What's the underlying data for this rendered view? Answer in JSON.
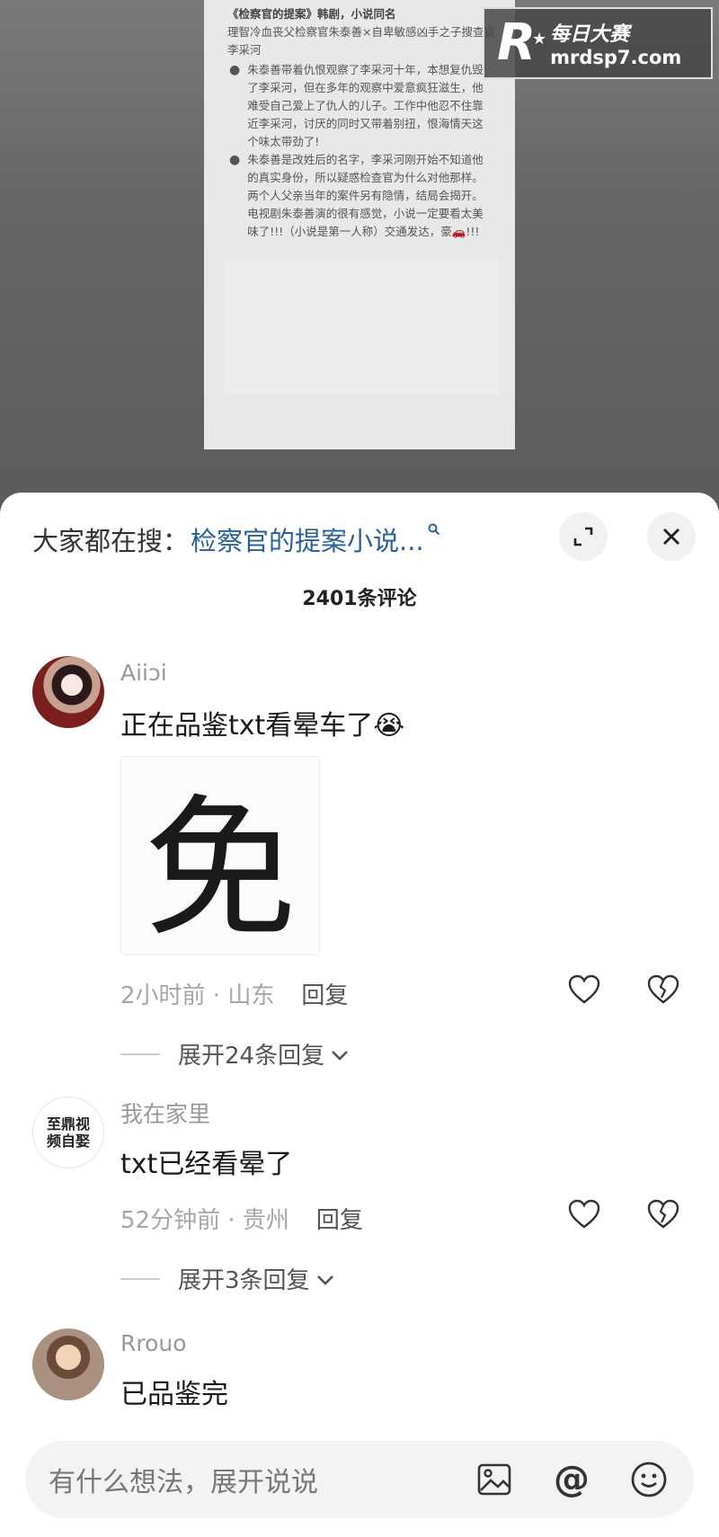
{
  "post": {
    "title": "《检察官的提案》韩剧，小说同名",
    "subtitle": "理智冷血丧父检察官朱泰善×自卑敏感凶手之子搜查官李采河",
    "bullets": [
      "朱泰善带着仇恨观察了李采河十年，本想复仇毁了李采河，但在多年的观察中爱意疯狂滋生，他难受自己爱上了仇人的儿子。工作中他忍不住靠近李采河，讨厌的同时又带着别扭，恨海情天这个味太带劲了!",
      "朱泰善是改姓后的名字，李采河刚开始不知道他的真实身份，所以疑惑检查官为什么对他那样。两个人父亲当年的案件另有隐情，结局会揭开。电视剧朱泰善演的很有感觉，小说一定要看太美味了!!!（小说是第一人称）交通发达，豪🚗!!!"
    ]
  },
  "watermark": {
    "logo": "R",
    "name": "每日大赛",
    "url": "mrdsp7.com"
  },
  "sheet": {
    "search_prefix": "大家都在搜：",
    "search_hot": "检察官的提案小说...",
    "comment_count": "2401条评论"
  },
  "comments": [
    {
      "user": "Aiiↄi",
      "text": "正在品鉴txt看晕车了😭",
      "sticker": "免",
      "time_loc": "2小时前 · 山东",
      "reply": "回复",
      "expand": "展开24条回复"
    },
    {
      "user": "我在家里",
      "avatar_text": "至鼎视频自娶",
      "text": "txt已经看晕了",
      "time_loc": "52分钟前 · 贵州",
      "reply": "回复",
      "expand": "展开3条回复"
    },
    {
      "user": "Rrouo",
      "text": "已品鉴完"
    }
  ],
  "input": {
    "placeholder": "有什么想法，展开说说",
    "image_icon": "image-icon",
    "at_icon": "at-icon",
    "emoji_icon": "emoji-icon"
  }
}
